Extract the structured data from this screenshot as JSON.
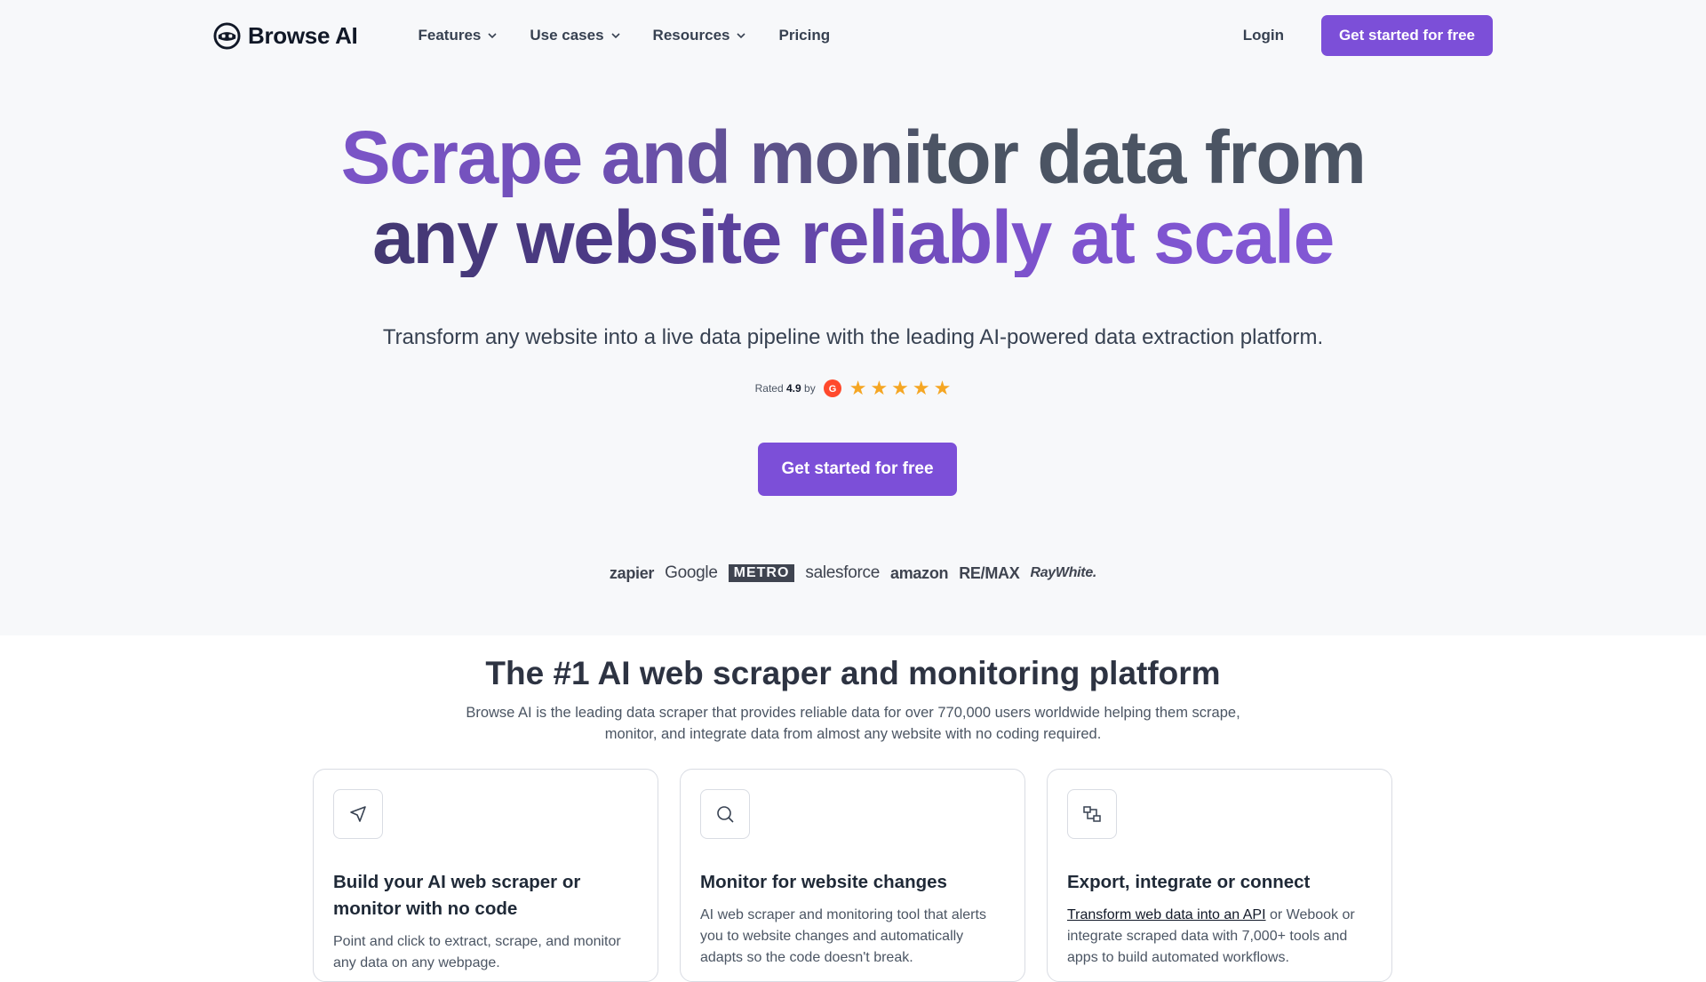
{
  "nav": {
    "logo_text": "Browse AI",
    "menu": [
      {
        "label": "Features",
        "has_dropdown": true
      },
      {
        "label": "Use cases",
        "has_dropdown": true
      },
      {
        "label": "Resources",
        "has_dropdown": true
      },
      {
        "label": "Pricing",
        "has_dropdown": false
      }
    ],
    "login_label": "Login",
    "cta_label": "Get started for free"
  },
  "hero": {
    "headline_line1_a": "Scrape and",
    "headline_line1_b": " monitor data from",
    "headline_line2_a": "any website",
    "headline_line2_b": " reliably at scale",
    "subheadline": "Transform any website into a live data pipeline with the leading AI-powered data extraction platform.",
    "rating_prefix": "Rated",
    "rating_value": "4.9",
    "rating_suffix": "by",
    "rating_stars": 5,
    "cta_label": "Get started for free"
  },
  "customer_logos": [
    "zapier",
    "Google",
    "METRO",
    "salesforce",
    "amazon",
    "RE/MAX",
    "RayWhite."
  ],
  "features_section": {
    "title": "The #1 AI web scraper and monitoring platform",
    "description": "Browse AI is the leading data scraper that provides reliable data for over 770,000 users worldwide helping them scrape, monitor, and integrate data from almost any website with no coding required.",
    "cards": [
      {
        "icon": "send-icon",
        "title": "Build your AI web scraper or monitor with no code",
        "body": "Point and click to extract, scrape, and monitor any data on any webpage."
      },
      {
        "icon": "search-icon",
        "title": "Monitor for website changes",
        "body": "AI web scraper and monitoring tool that alerts you to website changes and automatically adapts so the code doesn't break."
      },
      {
        "icon": "integration-icon",
        "title": "Export, integrate or connect",
        "link_text": "Transform web data into an API",
        "body": " or Webook or integrate scraped data with 7,000+ tools and apps to build automated workflows."
      }
    ]
  },
  "colors": {
    "accent": "#7c4fd8",
    "star": "#f5a623",
    "hero_bg": "#f7f8fa",
    "text_dark": "#1f2937"
  }
}
